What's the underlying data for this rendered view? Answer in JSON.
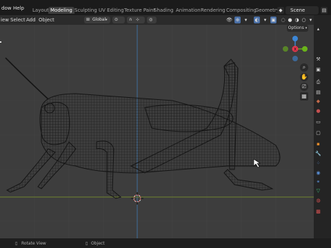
{
  "topbar": {
    "menus": [
      "dow",
      "Help"
    ],
    "workspace_tabs": [
      {
        "label": "Layout",
        "active": false
      },
      {
        "label": "Modeling",
        "active": true
      },
      {
        "label": "Sculpting",
        "active": false
      },
      {
        "label": "UV Editing",
        "active": false
      },
      {
        "label": "Texture Paint",
        "active": false
      },
      {
        "label": "Shading",
        "active": false
      },
      {
        "label": "Animation",
        "active": false
      },
      {
        "label": "Rendering",
        "active": false
      },
      {
        "label": "Compositing",
        "active": false
      },
      {
        "label": "Geometry N",
        "active": false
      }
    ],
    "scene_label": "Scene"
  },
  "viewport_header": {
    "menus": [
      "iew",
      "Select",
      "Add",
      "Object"
    ],
    "orientation_label": "Global",
    "options_label": "Options"
  },
  "gizmo": {
    "axis_colors": {
      "x": "#e3374e",
      "y": "#6ab41a",
      "z": "#3c86d6"
    },
    "axis_labels": {
      "x": "X",
      "y": "Y",
      "z": "Z"
    }
  },
  "nav_tools": [
    "zoom-icon",
    "pan-hand-icon",
    "camera-icon",
    "grid-icon"
  ],
  "properties_tabs": [
    "tool-icon",
    "render-icon",
    "output-icon",
    "view-layer-icon",
    "scene-icon",
    "world-icon",
    "collection-icon",
    "object-icon",
    "modifier-icon",
    "particles-icon",
    "physics-icon",
    "constraints-icon",
    "data-icon",
    "material-icon",
    "texture-icon"
  ],
  "status_bar": {
    "left_hint": "Rotate View",
    "mid_hint": "Object"
  }
}
